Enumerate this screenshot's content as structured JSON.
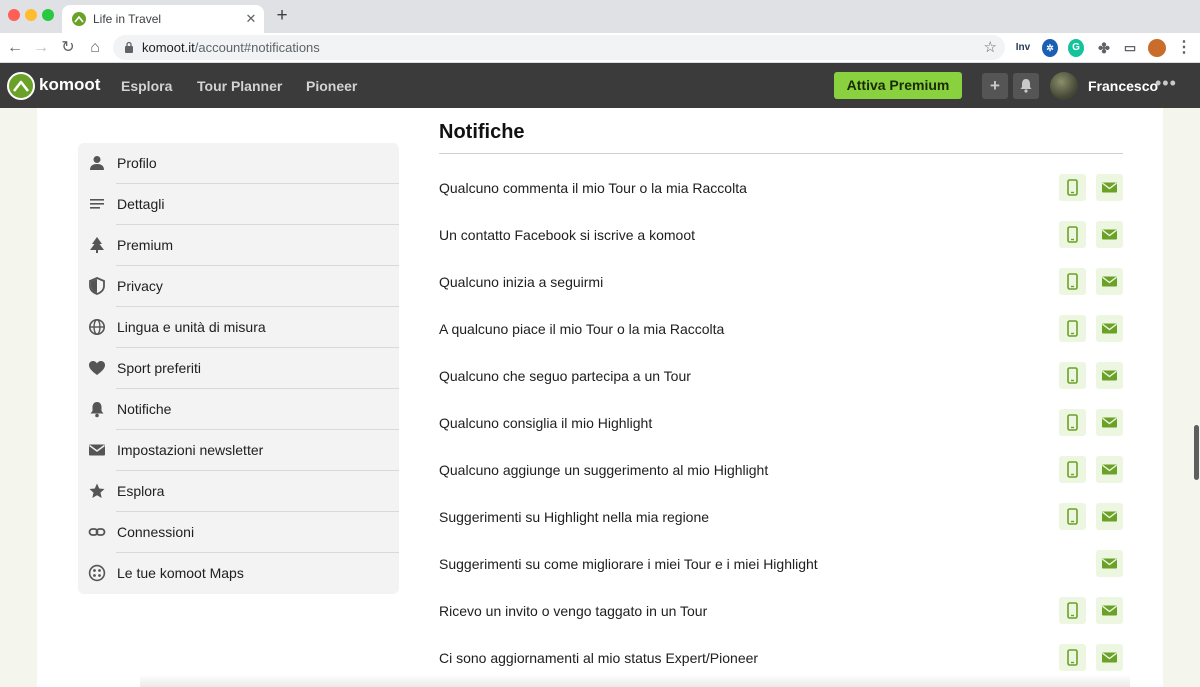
{
  "browser": {
    "tab_title": "Life in Travel",
    "url_domain": "komoot.it",
    "url_path": "/account#notifications",
    "ext_inv_label": "Inv"
  },
  "header": {
    "brand": "komoot",
    "nav": [
      "Esplora",
      "Tour Planner",
      "Pioneer"
    ],
    "premium_label": "Attiva Premium",
    "username": "Francesco"
  },
  "sidebar": {
    "items": [
      {
        "label": "Profilo",
        "icon": "person-icon"
      },
      {
        "label": "Dettagli",
        "icon": "list-icon"
      },
      {
        "label": "Premium",
        "icon": "tree-icon"
      },
      {
        "label": "Privacy",
        "icon": "shield-icon"
      },
      {
        "label": "Lingua e unità di misura",
        "icon": "globe-icon"
      },
      {
        "label": "Sport preferiti",
        "icon": "heart-icon"
      },
      {
        "label": "Notifiche",
        "icon": "bell-icon"
      },
      {
        "label": "Impostazioni newsletter",
        "icon": "envelope-icon"
      },
      {
        "label": "Esplora",
        "icon": "star-icon"
      },
      {
        "label": "Connessioni",
        "icon": "link-icon"
      },
      {
        "label": "Le tue komoot Maps",
        "icon": "maps-icon"
      }
    ]
  },
  "notifications": {
    "title": "Notifiche",
    "rows": [
      {
        "label": "Qualcuno commenta il mio Tour o la mia Raccolta",
        "phone": true,
        "mail": true
      },
      {
        "label": "Un contatto Facebook si iscrive a komoot",
        "phone": true,
        "mail": true
      },
      {
        "label": "Qualcuno inizia a seguirmi",
        "phone": true,
        "mail": true
      },
      {
        "label": "A qualcuno piace il mio Tour o la mia Raccolta",
        "phone": true,
        "mail": true
      },
      {
        "label": "Qualcuno che seguo partecipa a un Tour",
        "phone": true,
        "mail": true
      },
      {
        "label": "Qualcuno consiglia il mio Highlight",
        "phone": true,
        "mail": true
      },
      {
        "label": "Qualcuno aggiunge un suggerimento al mio Highlight",
        "phone": true,
        "mail": true
      },
      {
        "label": "Suggerimenti su Highlight nella mia regione",
        "phone": true,
        "mail": true
      },
      {
        "label": "Suggerimenti su come migliorare i miei Tour e i miei Highlight",
        "phone": false,
        "mail": true
      },
      {
        "label": "Ricevo un invito o vengo taggato in un Tour",
        "phone": true,
        "mail": true
      },
      {
        "label": "Ci sono aggiornamenti al mio status Expert/Pioneer",
        "phone": true,
        "mail": true
      }
    ]
  },
  "colors": {
    "accent": "#6aa127",
    "premium": "#8ad13f",
    "header_bg": "#3b3b3b"
  }
}
